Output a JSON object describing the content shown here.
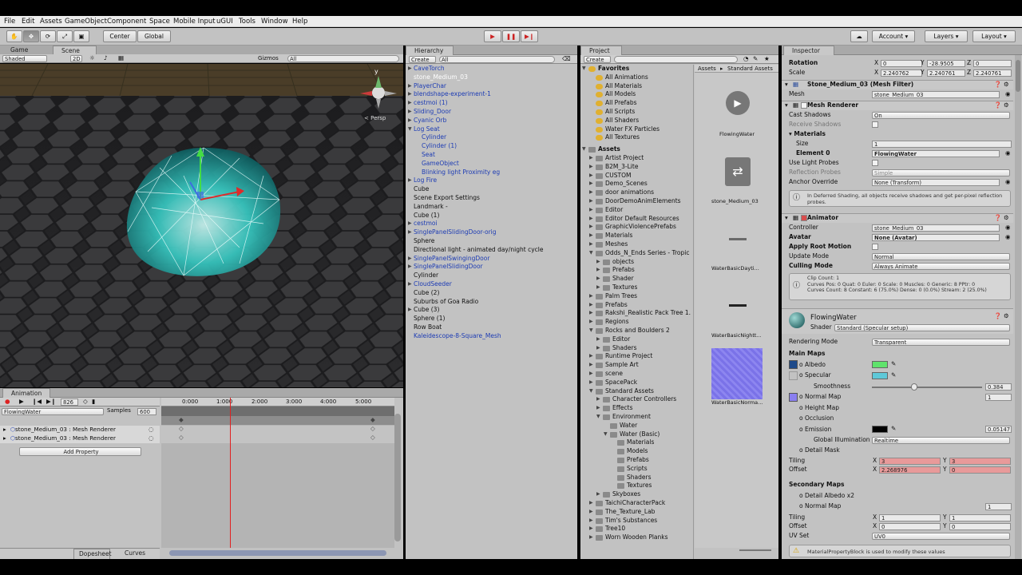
{
  "menu": [
    "File",
    "Edit",
    "Assets",
    "GameObject",
    "Component",
    "Space",
    "Mobile Input",
    "uGUI",
    "Tools",
    "Window",
    "Help"
  ],
  "toolbar": {
    "pivot": "Center",
    "space": "Global",
    "account": "Account",
    "layers": "Layers",
    "layout": "Layout"
  },
  "scene": {
    "tabs": [
      "Game",
      "Scene"
    ],
    "shading": "Shaded",
    "mode_2d": "2D",
    "gizmos": "Gizmos",
    "search": "All",
    "persp": "Persp",
    "gizmo_y": "y"
  },
  "animation": {
    "tab": "Animation",
    "frame": "826",
    "clip": "FlowingWater",
    "samples_label": "Samples",
    "samples": "600",
    "ticks": [
      "0:000",
      "1:000",
      "2:000",
      "3:000",
      "4:000",
      "5:000"
    ],
    "properties": [
      "stone_Medium_03 : Mesh Renderer",
      "stone_Medium_03 : Mesh Renderer"
    ],
    "add_property": "Add Property",
    "dopesheet": "Dopesheet",
    "curves": "Curves"
  },
  "hierarchy": {
    "tab": "Hierarchy",
    "create": "Create",
    "search": "All",
    "items": [
      {
        "label": "CaveTorch",
        "indent": 0,
        "arrow": true,
        "blue": true
      },
      {
        "label": "stone_Medium_03",
        "indent": 0,
        "arrow": false,
        "blue": false,
        "selected": true
      },
      {
        "label": "PlayerChar",
        "indent": 0,
        "arrow": true,
        "blue": true
      },
      {
        "label": "blendshape-experiment-1",
        "indent": 0,
        "arrow": true,
        "blue": true
      },
      {
        "label": "cestmoi (1)",
        "indent": 0,
        "arrow": true,
        "blue": true
      },
      {
        "label": "Sliding_Door",
        "indent": 0,
        "arrow": true,
        "blue": true
      },
      {
        "label": "Cyanic Orb",
        "indent": 0,
        "arrow": true,
        "blue": true
      },
      {
        "label": "Log Seat",
        "indent": 0,
        "arrow": true,
        "blue": true,
        "open": true
      },
      {
        "label": "Cylinder",
        "indent": 1,
        "arrow": false,
        "blue": true
      },
      {
        "label": "Cylinder (1)",
        "indent": 1,
        "arrow": false,
        "blue": true
      },
      {
        "label": "Seat",
        "indent": 1,
        "arrow": false,
        "blue": true
      },
      {
        "label": "GameObject",
        "indent": 1,
        "arrow": false,
        "blue": true
      },
      {
        "label": "Blinking light Proximity eg",
        "indent": 1,
        "arrow": false,
        "blue": true
      },
      {
        "label": "Log Fire",
        "indent": 0,
        "arrow": true,
        "blue": true
      },
      {
        "label": "Cube",
        "indent": 0,
        "arrow": false,
        "blue": false
      },
      {
        "label": "Scene Export Settings",
        "indent": 0,
        "arrow": false,
        "blue": false
      },
      {
        "label": "Landmark -",
        "indent": 0,
        "arrow": false,
        "blue": false
      },
      {
        "label": "Cube (1)",
        "indent": 0,
        "arrow": false,
        "blue": false
      },
      {
        "label": "cestmoi",
        "indent": 0,
        "arrow": true,
        "blue": true
      },
      {
        "label": "SinglePanelSlidingDoor-orig",
        "indent": 0,
        "arrow": true,
        "blue": true
      },
      {
        "label": "Sphere",
        "indent": 0,
        "arrow": false,
        "blue": false
      },
      {
        "label": "Directional light - animated day/night cycle",
        "indent": 0,
        "arrow": false,
        "blue": false
      },
      {
        "label": "SinglePanelSwingingDoor",
        "indent": 0,
        "arrow": true,
        "blue": true
      },
      {
        "label": "SinglePanelSlidingDoor",
        "indent": 0,
        "arrow": true,
        "blue": true
      },
      {
        "label": "Cylinder",
        "indent": 0,
        "arrow": false,
        "blue": false
      },
      {
        "label": "CloudSeeder",
        "indent": 0,
        "arrow": true,
        "blue": true
      },
      {
        "label": "Cube (2)",
        "indent": 0,
        "arrow": false,
        "blue": false
      },
      {
        "label": "Suburbs of Goa Radio",
        "indent": 0,
        "arrow": false,
        "blue": false
      },
      {
        "label": "Cube (3)",
        "indent": 0,
        "arrow": true,
        "blue": false
      },
      {
        "label": "Sphere (1)",
        "indent": 0,
        "arrow": false,
        "blue": false
      },
      {
        "label": "Row Boat",
        "indent": 0,
        "arrow": false,
        "blue": false
      },
      {
        "label": "Kaleidescope-8-Square_Mesh",
        "indent": 0,
        "arrow": false,
        "blue": true
      }
    ]
  },
  "project": {
    "tab": "Project",
    "create": "Create",
    "breadcrumb": [
      "Assets",
      "Standard Assets"
    ],
    "favorites_label": "Favorites",
    "favorites": [
      "All Animations",
      "All Materials",
      "All Models",
      "All Prefabs",
      "All Scripts",
      "All Shaders",
      "Water FX Particles",
      "All Textures"
    ],
    "assets_label": "Assets",
    "tree": [
      {
        "label": "Artist Project",
        "indent": 1
      },
      {
        "label": "B2M_3-Lite",
        "indent": 1
      },
      {
        "label": "CUSTOM",
        "indent": 1
      },
      {
        "label": "Demo_Scenes",
        "indent": 1
      },
      {
        "label": "door animations",
        "indent": 1
      },
      {
        "label": "DoorDemoAnimElements",
        "indent": 1
      },
      {
        "label": "Editor",
        "indent": 1
      },
      {
        "label": "Editor Default Resources",
        "indent": 1
      },
      {
        "label": "GraphicViolencePrefabs",
        "indent": 1
      },
      {
        "label": "Materials",
        "indent": 1
      },
      {
        "label": "Meshes",
        "indent": 1
      },
      {
        "label": "Odds_N_Ends Series - Tropic",
        "indent": 1,
        "open": true
      },
      {
        "label": "objects",
        "indent": 2
      },
      {
        "label": "Prefabs",
        "indent": 2
      },
      {
        "label": "Shader",
        "indent": 2
      },
      {
        "label": "Textures",
        "indent": 2
      },
      {
        "label": "Palm Trees",
        "indent": 1
      },
      {
        "label": "Prefabs",
        "indent": 1
      },
      {
        "label": "Rakshi_Realistic Pack Tree 1.",
        "indent": 1
      },
      {
        "label": "Regions",
        "indent": 1
      },
      {
        "label": "Rocks and Boulders 2",
        "indent": 1,
        "open": true
      },
      {
        "label": "Editor",
        "indent": 2
      },
      {
        "label": "Shaders",
        "indent": 2
      },
      {
        "label": "Runtime Project",
        "indent": 1
      },
      {
        "label": "Sample Art",
        "indent": 1
      },
      {
        "label": "scene",
        "indent": 1
      },
      {
        "label": "SpacePack",
        "indent": 1
      },
      {
        "label": "Standard Assets",
        "indent": 1,
        "open": true
      },
      {
        "label": "Character Controllers",
        "indent": 2
      },
      {
        "label": "Effects",
        "indent": 2
      },
      {
        "label": "Environment",
        "indent": 2,
        "open": true
      },
      {
        "label": "Water",
        "indent": 3
      },
      {
        "label": "Water (Basic)",
        "indent": 3,
        "open": true
      },
      {
        "label": "Materials",
        "indent": 4
      },
      {
        "label": "Models",
        "indent": 4
      },
      {
        "label": "Prefabs",
        "indent": 4
      },
      {
        "label": "Scripts",
        "indent": 4
      },
      {
        "label": "Shaders",
        "indent": 4
      },
      {
        "label": "Textures",
        "indent": 4,
        "selected": true
      },
      {
        "label": "Skyboxes",
        "indent": 2
      },
      {
        "label": "TaichiCharacterPack",
        "indent": 1
      },
      {
        "label": "The_Texture_Lab",
        "indent": 1
      },
      {
        "label": "Tim's Substances",
        "indent": 1
      },
      {
        "label": "Tree10",
        "indent": 1
      },
      {
        "label": "Worn Wooden Planks",
        "indent": 1
      }
    ],
    "thumbs": [
      "FlowingWater",
      "stone_Medium_03",
      "WaterBasicDayti...",
      "WaterBasicNightt...",
      "WaterBasicNorma..."
    ]
  },
  "inspector": {
    "tab": "Inspector",
    "transform": {
      "rotation_label": "Rotation",
      "rot_x": "0",
      "rot_y": "-28.9505",
      "rot_z": "0",
      "scale_label": "Scale",
      "scale_x": "2.240762",
      "scale_y": "2.240761",
      "scale_z": "2.240761"
    },
    "mesh_filter": {
      "title": "Stone_Medium_03 (Mesh Filter)",
      "mesh_label": "Mesh",
      "mesh": "stone_Medium_03"
    },
    "mesh_renderer": {
      "title": "Mesh Renderer",
      "cast_shadows_label": "Cast Shadows",
      "cast_shadows": "On",
      "receive_shadows_label": "Receive Shadows",
      "materials_label": "Materials",
      "size_label": "Size",
      "size": "1",
      "element0_label": "Element 0",
      "element0": "FlowingWater",
      "light_probes_label": "Use Light Probes",
      "reflection_label": "Reflection Probes",
      "reflection": "Simple",
      "anchor_label": "Anchor Override",
      "anchor": "None (Transform)",
      "info": "In Deferred Shading, all objects receive shadows and get per-pixel reflection probes."
    },
    "animator": {
      "title": "Animator",
      "controller_label": "Controller",
      "controller": "stone_Medium_03",
      "avatar_label": "Avatar",
      "avatar": "None (Avatar)",
      "root_motion_label": "Apply Root Motion",
      "update_label": "Update Mode",
      "update": "Normal",
      "culling_label": "Culling Mode",
      "culling": "Always Animate",
      "info": "Clip Count: 1\nCurves Pos: 0 Quat: 0 Euler: 0 Scale: 0 Muscles: 0 Generic: 8 PPtr: 0\nCurves Count: 8 Constant: 6 (75.0%) Dense: 0 (0.0%) Stream: 2 (25.0%)"
    },
    "material": {
      "name": "FlowingWater",
      "shader_label": "Shader",
      "shader": "Standard (Specular setup)",
      "rendering_mode_label": "Rendering Mode",
      "rendering_mode": "Transparent",
      "main_maps": "Main Maps",
      "albedo": "Albedo",
      "specular": "Specular",
      "smoothness": "Smoothness",
      "smoothness_value": "0.384",
      "smoothness_level": 0.384,
      "normal_map": "Normal Map",
      "normal_scale": "1",
      "height_map": "Height Map",
      "occlusion": "Occlusion",
      "emission": "Emission",
      "emission_value": "0.05147",
      "gi_label": "Global Illumination",
      "gi": "Realtime",
      "detail_mask": "Detail Mask",
      "tiling_label": "Tiling",
      "tiling_x": "3",
      "tiling_y": "3",
      "offset_label": "Offset",
      "offset_x": "2.268976",
      "offset_y": "0",
      "secondary_maps": "Secondary Maps",
      "detail_albedo": "Detail Albedo x2",
      "normal_map2": "Normal Map",
      "normal_scale2": "1",
      "tiling2_x": "1",
      "tiling2_y": "1",
      "offset2_x": "0",
      "offset2_y": "0",
      "uv_label": "UV Set",
      "uv": "UV0",
      "warning": "MaterialPropertyBlock is used to modify these values"
    },
    "colors": {
      "albedo": "#5fe36c",
      "specular": "#5ec8d8",
      "emission": "#000000",
      "accent": "#d83a2a"
    }
  }
}
